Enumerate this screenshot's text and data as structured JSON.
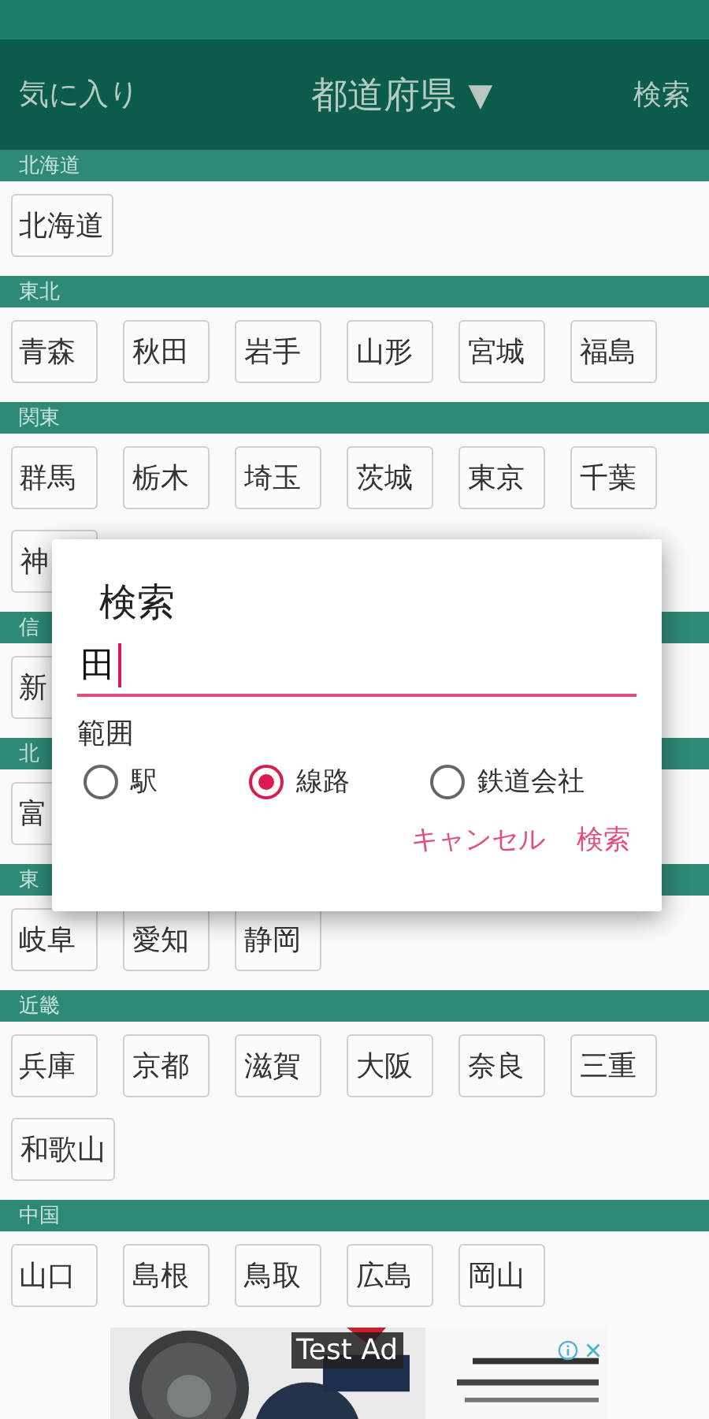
{
  "header": {
    "favorites": "気に入り",
    "title": "都道府県",
    "dropdown_arrow": "▼",
    "search": "検索"
  },
  "regions": [
    {
      "name": "北海道",
      "prefectures": [
        "北海道"
      ]
    },
    {
      "name": "東北",
      "prefectures": [
        "青森",
        "秋田",
        "岩手",
        "山形",
        "宮城",
        "福島"
      ]
    },
    {
      "name": "関東",
      "prefectures": [
        "群馬",
        "栃木",
        "埼玉",
        "茨城",
        "東京",
        "千葉",
        "神"
      ]
    },
    {
      "name": "信",
      "prefectures": [
        "新"
      ]
    },
    {
      "name": "北",
      "prefectures": [
        "富"
      ]
    },
    {
      "name": "東",
      "prefectures": [
        "岐阜",
        "愛知",
        "静岡"
      ]
    },
    {
      "name": "近畿",
      "prefectures": [
        "兵庫",
        "京都",
        "滋賀",
        "大阪",
        "奈良",
        "三重",
        "和歌山"
      ]
    },
    {
      "name": "中国",
      "prefectures": [
        "山口",
        "島根",
        "鳥取",
        "広島",
        "岡山"
      ]
    }
  ],
  "dialog": {
    "title": "検索",
    "input_value": "田",
    "range_label": "範囲",
    "options": [
      {
        "label": "駅",
        "selected": false
      },
      {
        "label": "線路",
        "selected": true
      },
      {
        "label": "鉄道会社",
        "selected": false
      }
    ],
    "buttons": [
      "キャンセル",
      "検索"
    ]
  },
  "ad": {
    "label": "Test Ad"
  }
}
